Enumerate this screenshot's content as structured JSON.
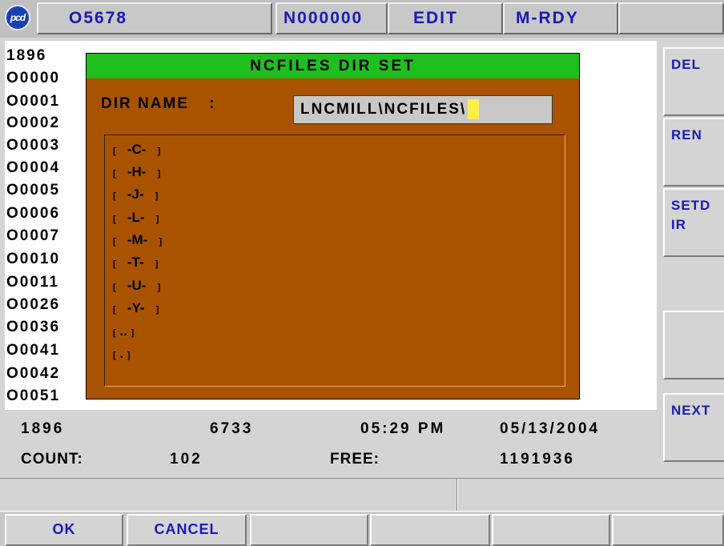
{
  "topbar": {
    "logo_text": "pcd",
    "program": "O5678",
    "sequence": "N000000",
    "mode": "EDIT",
    "status": "M-RDY"
  },
  "programs": [
    "1896",
    "O0000",
    "O0001",
    "O0002",
    "O0003",
    "O0004",
    "O0005",
    "O0006",
    "O0007",
    "O0010",
    "O0011",
    "O0026",
    "O0036",
    "O0041",
    "O0042",
    "O0051"
  ],
  "dialog": {
    "title": "NCFILES DIR SET",
    "dir_label": "DIR NAME",
    "dir_colon": ":",
    "dir_value": "LNCMILL\\NCFILES\\",
    "entries": [
      "-C-",
      "-H-",
      "-J-",
      "-L-",
      "-M-",
      "-T-",
      "-U-",
      "-Y-",
      "..",
      "."
    ]
  },
  "info": {
    "current": "1896",
    "size": "6733",
    "time": "05:29 PM",
    "date": "05/13/2004",
    "count_label": "COUNT:",
    "count_value": "102",
    "free_label": "FREE:",
    "free_value": "1191936"
  },
  "softkeys_right": [
    "DEL",
    "REN",
    "SETD\nIR",
    "",
    "NEXT"
  ],
  "softkeys_bottom": [
    "OK",
    "CANCEL",
    "",
    "",
    "",
    ""
  ],
  "colors": {
    "dialog_bg": "#a95300",
    "title_bg": "#1fbf1f",
    "key_text": "#1a1ab8",
    "cursor": "#ffef4a"
  }
}
